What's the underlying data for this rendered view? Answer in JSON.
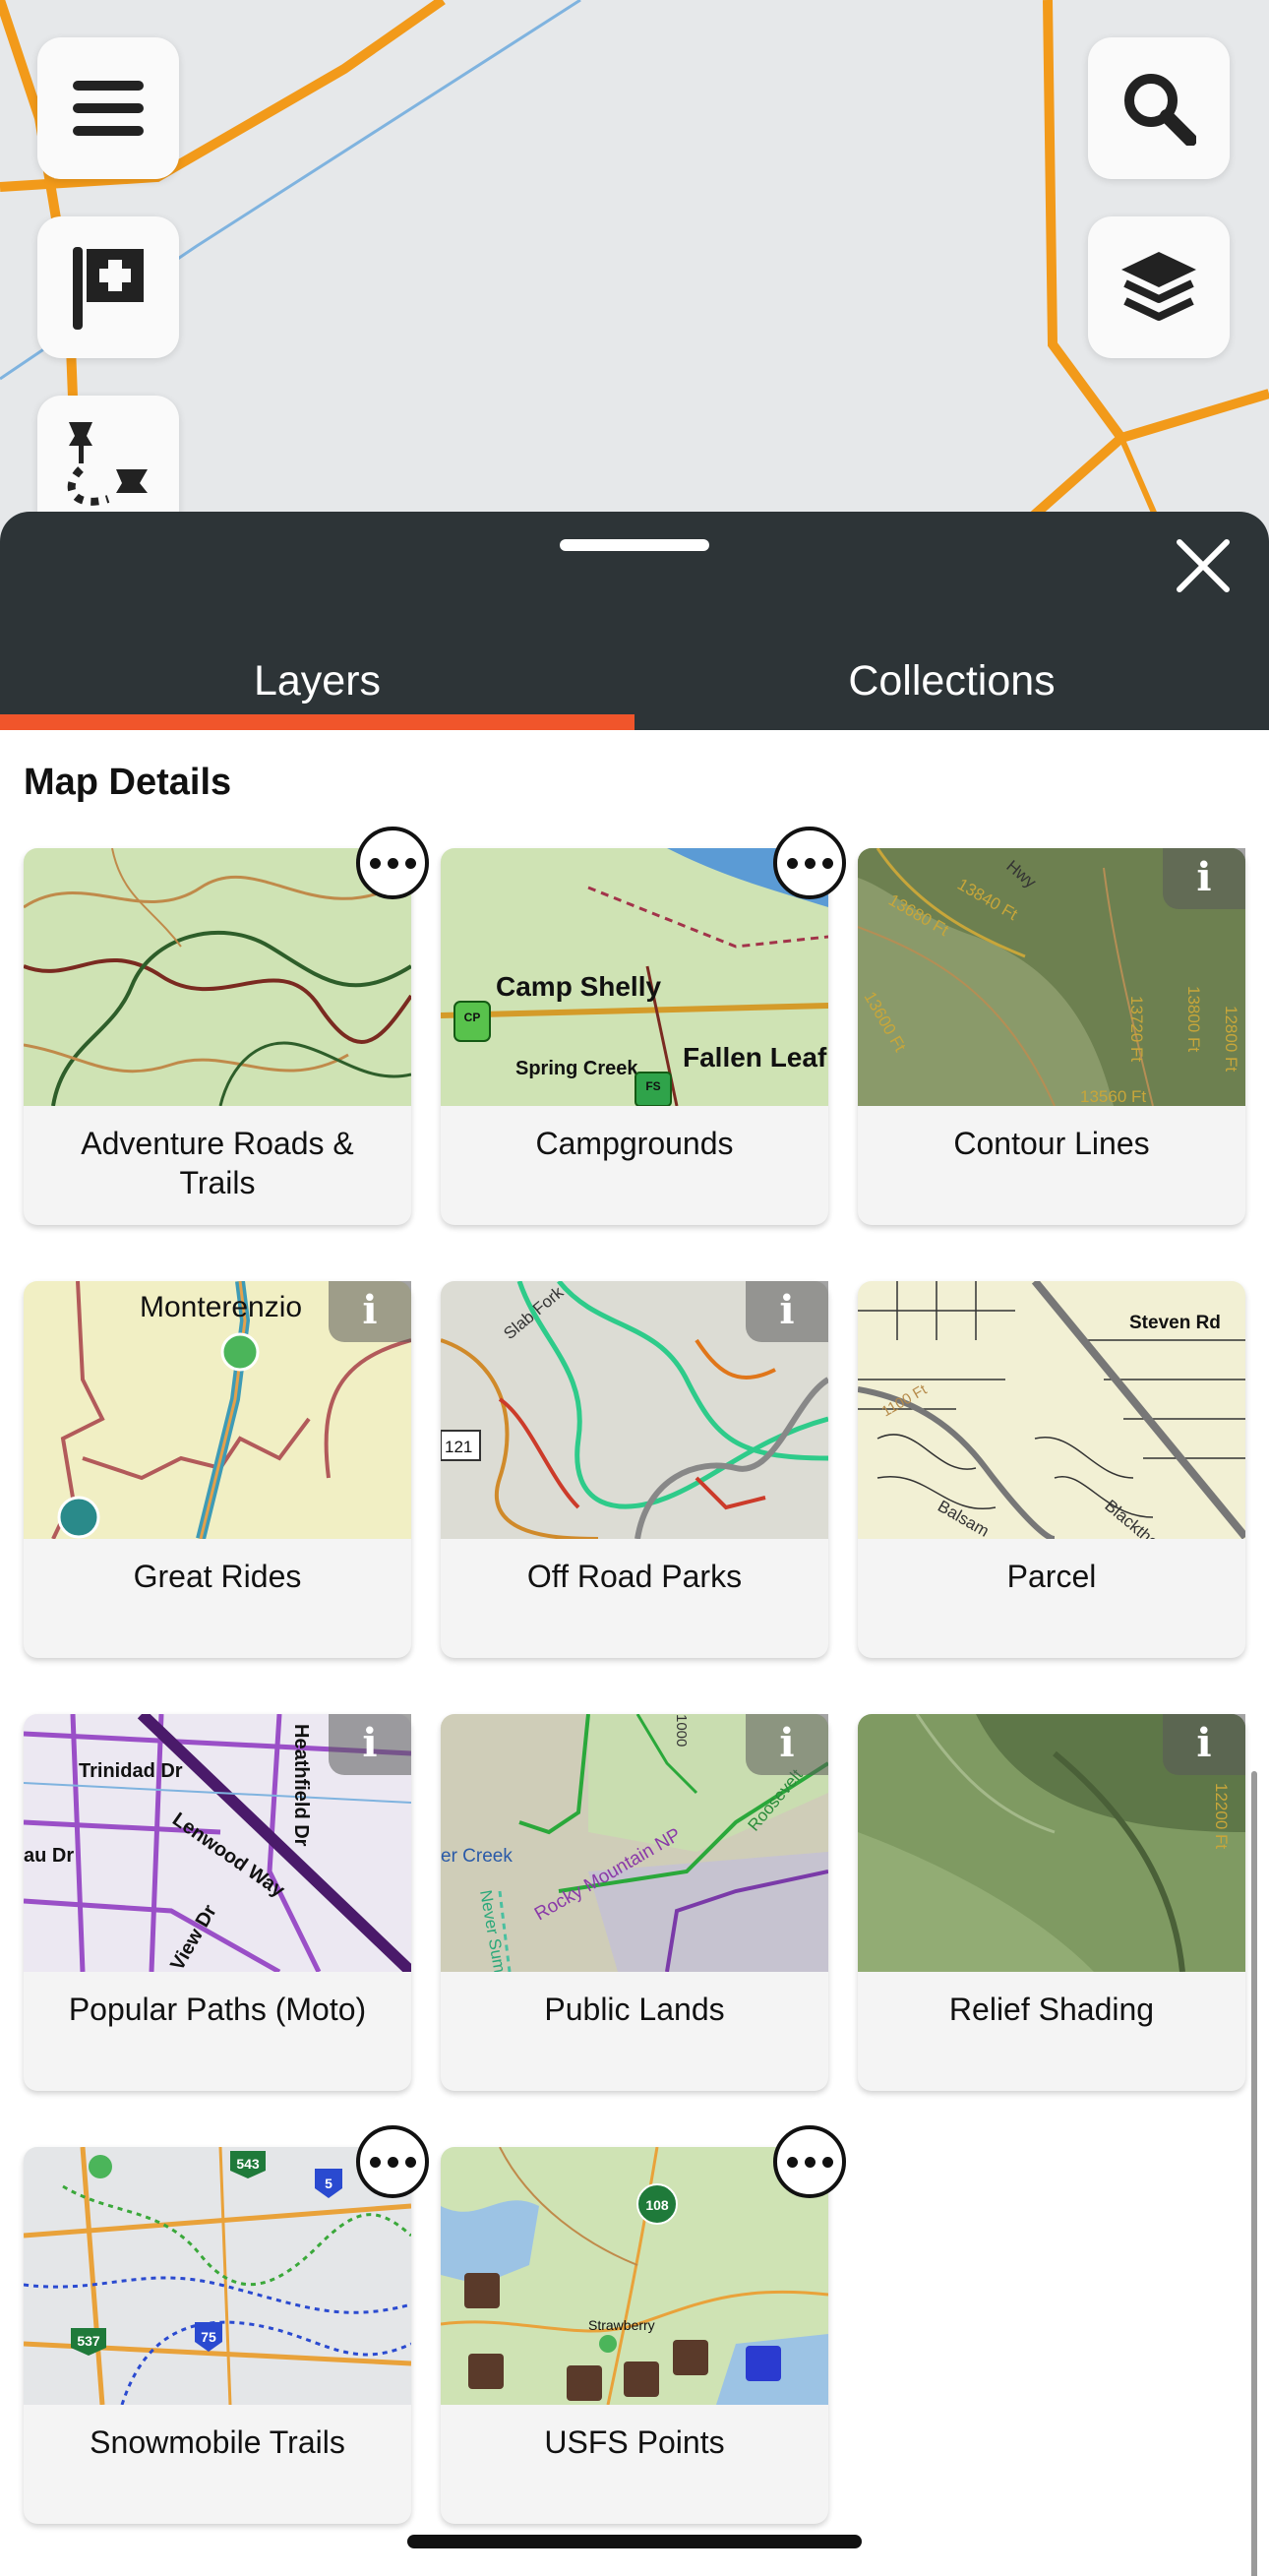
{
  "map": {
    "buttons": {
      "menu_icon": "hamburger-menu-icon",
      "add_waypoint_icon": "flag-plus-icon",
      "route_icon": "route-builder-icon",
      "search_icon": "search-icon",
      "layers_icon": "layers-icon"
    }
  },
  "sheet": {
    "tabs": [
      {
        "label": "Layers",
        "active": true
      },
      {
        "label": "Collections",
        "active": false
      }
    ],
    "section_title": "Map Details",
    "accent_color": "#f0552b",
    "header_color": "#2d3437"
  },
  "layers": [
    {
      "label": "Adventure Roads & Trails",
      "badge": "more"
    },
    {
      "label": "Campgrounds",
      "badge": "more",
      "map_text": [
        "Camp Shelly",
        "Spring Creek",
        "Fallen Leaf",
        "CP",
        "FS"
      ]
    },
    {
      "label": "Contour Lines",
      "badge": "info",
      "badge_text": "i",
      "map_text": [
        "13680 Ft",
        "13840 Ft",
        "13600 Ft",
        "13720 Ft",
        "13800 Ft",
        "12800 Ft",
        "13560 Ft",
        "Hwy"
      ]
    },
    {
      "label": "Great Rides",
      "badge": "info",
      "badge_text": "i",
      "map_text": [
        "Monterenzio"
      ]
    },
    {
      "label": "Off Road Parks",
      "badge": "info",
      "badge_text": "i",
      "map_text": [
        "Slab Fork",
        "121"
      ]
    },
    {
      "label": "Parcel",
      "badge": "none",
      "map_text": [
        "Steven Rd",
        "1100 Ft",
        "Balsam",
        "Blackthorn"
      ]
    },
    {
      "label": "Popular Paths (Moto)",
      "badge": "info",
      "badge_text": "i",
      "map_text": [
        "Trinidad Dr",
        "Lenwood Way",
        "Heathfield Dr",
        "View Dr",
        "au Dr"
      ]
    },
    {
      "label": "Public Lands",
      "badge": "info",
      "badge_text": "i",
      "map_text": [
        "er Creek",
        "Rocky Mountain NP",
        "Roosevelt",
        "Never Summer",
        "1000"
      ]
    },
    {
      "label": "Relief Shading",
      "badge": "info",
      "badge_text": "i",
      "map_text": [
        "12200 Ft"
      ]
    },
    {
      "label": "Snowmobile Trails",
      "badge": "more",
      "map_text": [
        "543",
        "5",
        "537",
        "75"
      ]
    },
    {
      "label": "USFS Points",
      "badge": "more",
      "map_text": [
        "108",
        "Strawberry"
      ]
    }
  ]
}
